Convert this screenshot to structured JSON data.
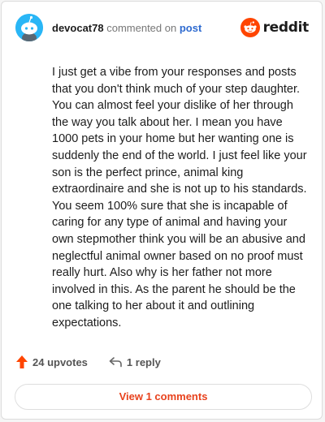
{
  "comment": {
    "username": "devocat78",
    "commented_on": "commented on",
    "post_link": "post",
    "text": "I just get a vibe from your responses and posts that you don't think much of your step daughter. You can almost feel your dislike of her through the way you talk about her. I mean you have 1000 pets in your home but her wanting one is suddenly the end of the world. I just feel like your son is the perfect prince, animal king extraordinaire and she is not up to his standards. You seem 100% sure that she is incapable of caring for any type of animal and having your own stepmother think you will be an abusive and neglectful animal owner based on no proof must really hurt. Also why is her father not more involved in this. As the parent he should be the one talking to her about it and outlining expectations."
  },
  "brand": {
    "wordmark": "reddit",
    "icon": "reddit-snoo-icon",
    "color": "#ff4500"
  },
  "actions": {
    "upvotes_label": "24 upvotes",
    "reply_label": "1 reply",
    "upvote_icon": "upvote-arrow-icon",
    "reply_icon": "reply-arrow-icon"
  },
  "view_comments_label": "View 1 comments",
  "colors": {
    "accent": "#e8421d",
    "avatar_bg": "#29b6f6",
    "link": "#2f6bd0"
  }
}
